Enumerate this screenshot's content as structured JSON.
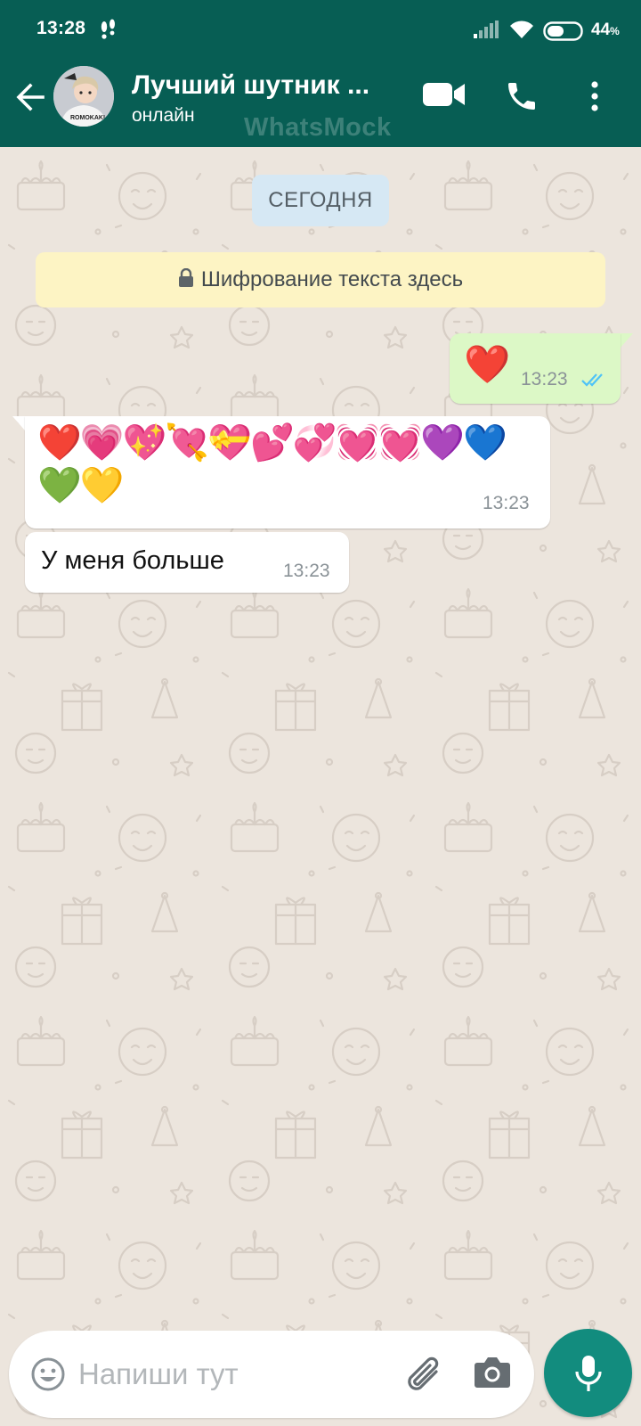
{
  "status_bar": {
    "time": "13:28",
    "battery_percent": "44",
    "battery_symbol": "%"
  },
  "header": {
    "contact_name": "Лучший шутник ...",
    "contact_status": "онлайн",
    "watermark": "WhatsMock",
    "icons": [
      "arrow-left-icon",
      "video-icon",
      "phone-icon",
      "more-vert-icon"
    ]
  },
  "chat": {
    "date_chip": "СЕГОДНЯ",
    "encryption_notice": "Шифрование текста здесь",
    "messages": [
      {
        "direction": "outgoing",
        "text": "❤️",
        "time": "13:23",
        "status": "read"
      },
      {
        "direction": "incoming",
        "text": "❤️💗💖💘💝💕💞💓💓💜💙💚💛",
        "time": "13:23"
      },
      {
        "direction": "incoming",
        "text": "У меня больше",
        "time": "13:23"
      }
    ]
  },
  "input": {
    "placeholder": "Напиши тут"
  },
  "colors": {
    "header": "#075e54",
    "outgoing_bubble": "#dcf8c6",
    "incoming_bubble": "#ffffff",
    "chat_background": "#ece5dd",
    "mic_button": "#128c7e",
    "read_ticks": "#4fc3f7"
  }
}
